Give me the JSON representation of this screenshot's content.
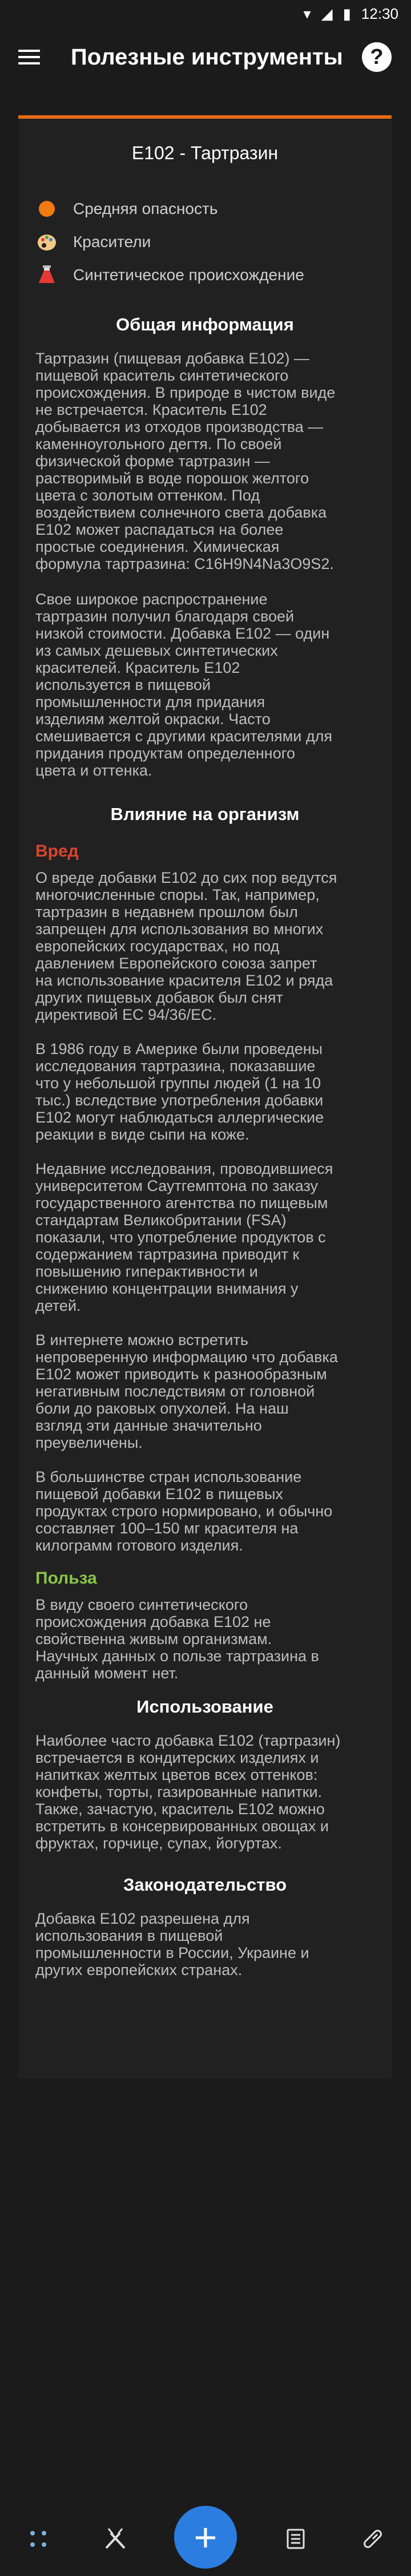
{
  "status": {
    "time": "12:30"
  },
  "app": {
    "title": "Полезные инструменты",
    "help_label": "?"
  },
  "card": {
    "title": "E102 - Тартразин",
    "chips": [
      {
        "label": "Средняя опасность",
        "icon": "orange-dot-icon"
      },
      {
        "label": "Красители",
        "icon": "palette-icon"
      },
      {
        "label": "Синтетическое происхождение",
        "icon": "flask-icon"
      }
    ],
    "general": {
      "heading": "Общая информация",
      "p1": "Тартразин (пищевая добавка E102) —\nпищевой краситель синтетического\nпроисхождения. В природе в чистом виде\nне встречается. Краситель E102\nдобывается из отходов производства —\nкаменноугольного дегтя. По своей\nфизической форме тартразин —\nрастворимый в воде порошок желтого\nцвета с золотым оттенком. Под\nвоздействием солнечного света добавка\nE102 может распадаться на более\nпростые соединения. Химическая\nформула тартразина: C16H9N4Na3O9S2.",
      "p2": "Свое широкое распространение\nтартразин получил благодаря своей\nнизкой стоимости. Добавка E102 — один\nиз самых дешевых синтетических\nкрасителей. Краситель E102\nиспользуется в пищевой\nпромышленности для придания\nизделиям желтой окраски. Часто\nсмешивается с другими красителями для\nпридания продуктам определенного\nцвета и оттенка."
    },
    "effects": {
      "heading": "Влияние на организм",
      "harm_label": "Вред",
      "h1": "О вреде добавки E102 до сих пор ведутся\nмногочисленные споры. Так, например,\nтартразин в недавнем прошлом был\nзапрещен для использования во многих\nевропейских государствах, но под\nдавлением Европейского союза запрет\nна использование красителя E102 и ряда\nдругих пищевых добавок был снят\nдирективой ЕС 94/36/ЕС.",
      "h2": "В 1986 году в Америке были проведены\nисследования тартразина, показавшие\nчто у небольшой группы людей (1 на 10\nтыс.) вследствие употребления добавки\nE102 могут наблюдаться аллергические\nреакции в виде сыпи на коже.",
      "h3": "Недавние исследования, проводившиеся\nуниверситетом Саутгемптона по заказу\nгосударственного агентства по пищевым\nстандартам Великобритании (FSA)\nпоказали, что употребление продуктов с\nсодержанием тартразина приводит к\nповышению гиперактивности и\nснижению концентрации внимания у\nдетей.",
      "h4": "В интернете можно встретить\nнепроверенную информацию что добавка\nE102 может приводить к разнообразным\nнегативным последствиям от головной\nболи до раковых опухолей. На наш\nвзгляд эти данные значительно\nпреувеличены.",
      "h5": "В большинстве стран использование\nпищевой добавки E102 в пищевых\nпродуктах строго нормировано, и обычно\nсоставляет 100–150 мг красителя на\nкилограмм готового изделия.",
      "benefit_label": "Польза",
      "b1": "В виду своего синтетического\nпроисхождения добавка E102 не\nсвойственна живым организмам.\nНаучных данных о пользе тартразина в\nданный момент нет."
    },
    "usage": {
      "heading": "Использование",
      "p1": "Наиболее часто добавка E102 (тартразин)\nвстречается в кондитерских изделиях и\nнапитках желтых цветов всех оттенков:\nконфеты, торты, газированные напитки.\nТакже, зачастую, краситель E102 можно\nвстретить в консервированных овощах и\nфруктах, горчице, супах, йогуртах."
    },
    "law": {
      "heading": "Законодательство",
      "p1": "Добавка E102 разрешена для\nиспользования в пищевой\nпромышленности в России, Украине и\nдругих европейских странах."
    }
  },
  "colors": {
    "accent": "#e66a16",
    "harm": "#d9442e",
    "benefit": "#8bc34a",
    "fab": "#2b7de0"
  },
  "nav": {
    "fab_label": "+",
    "icons": [
      "grid-icon",
      "fork-knife-icon",
      "add-icon",
      "list-icon",
      "pill-icon"
    ]
  }
}
